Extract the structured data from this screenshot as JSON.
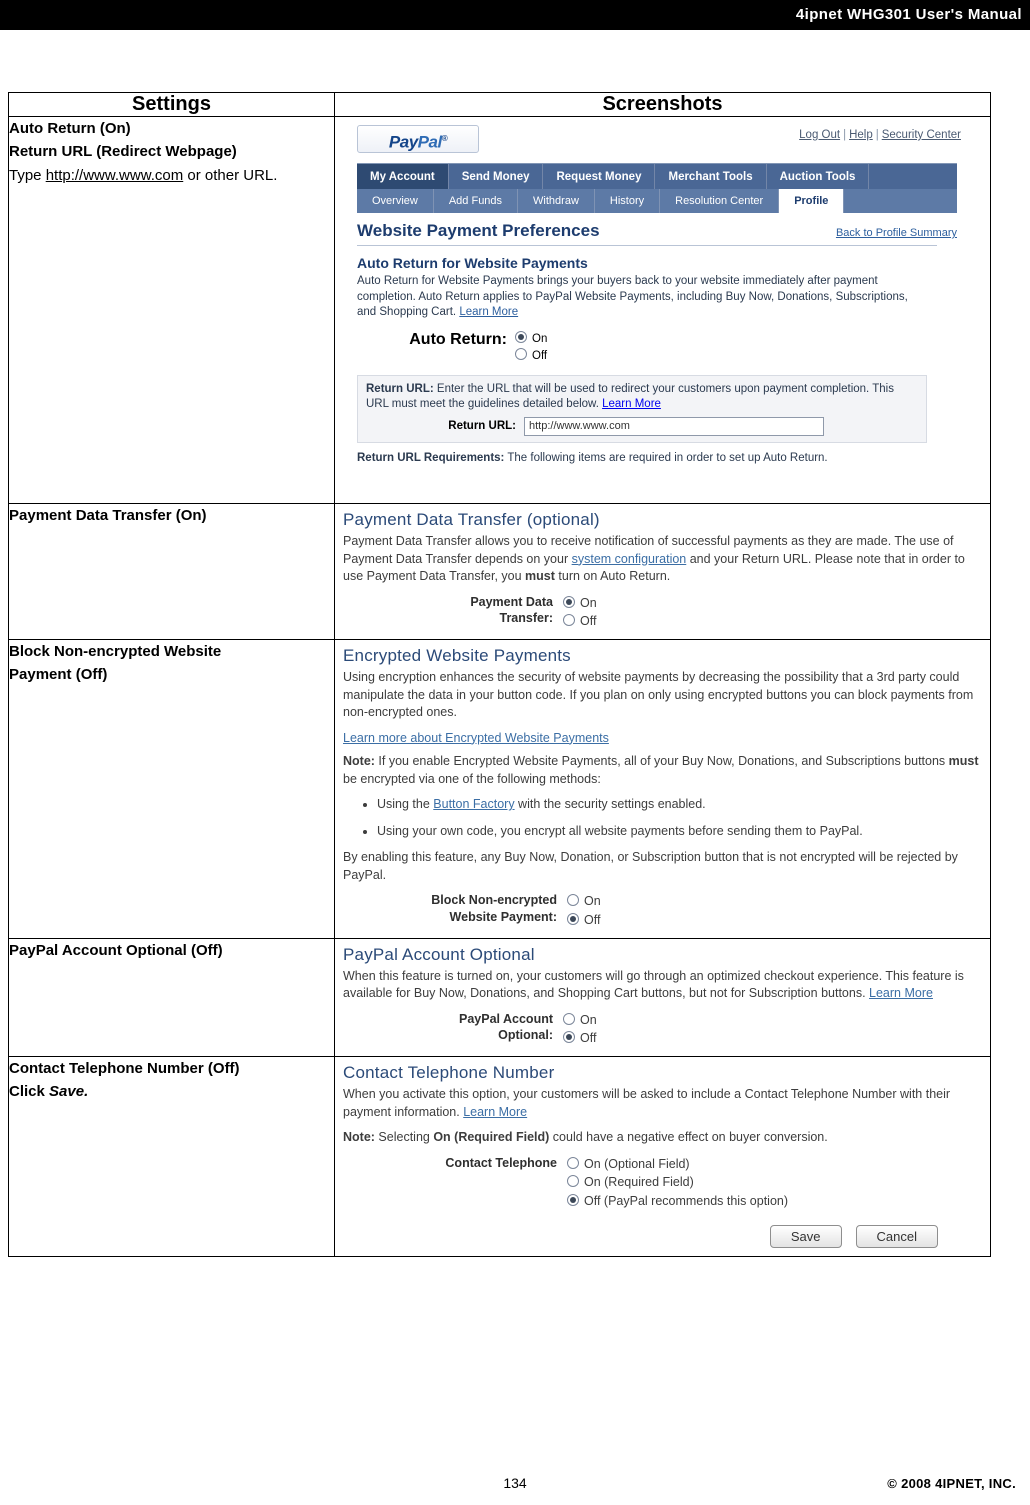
{
  "header": {
    "manual_title": "4ipnet WHG301 User's Manual"
  },
  "table": {
    "headers": {
      "settings": "Settings",
      "screenshots": "Screenshots"
    },
    "rows": [
      {
        "settings": {
          "line1": "Auto Return (On)",
          "line2": "Return URL (Redirect Webpage)",
          "line3_pre": "Type ",
          "line3_link": "http://www.www.com",
          "line3_post": " or other URL."
        }
      },
      {
        "settings": {
          "line1": "Payment Data Transfer (On)"
        }
      },
      {
        "settings": {
          "line1": "Block Non-encrypted Website",
          "line2": "Payment (Off)"
        }
      },
      {
        "settings": {
          "line1": "PayPal Account Optional (Off)"
        }
      },
      {
        "settings": {
          "line1": "Contact Telephone Number (Off)",
          "line2_pre": "Click ",
          "line2_em": "Save."
        }
      }
    ]
  },
  "shot1": {
    "logo_pay": "Pay",
    "logo_pal": "Pal",
    "logo_reg": "®",
    "toplinks": {
      "logout": "Log Out",
      "help": "Help",
      "security": "Security Center"
    },
    "nav_primary": [
      "My Account",
      "Send Money",
      "Request Money",
      "Merchant Tools",
      "Auction Tools"
    ],
    "nav_primary_selected": "My Account",
    "nav_secondary": [
      "Overview",
      "Add Funds",
      "Withdraw",
      "History",
      "Resolution Center",
      "Profile"
    ],
    "nav_secondary_selected": "Profile",
    "page_title": "Website Payment Preferences",
    "back_link": "Back to Profile Summary",
    "section_title": "Auto Return for Website Payments",
    "section_text": "Auto Return for Website Payments brings your buyers back to your website immediately after payment completion. Auto Return applies to PayPal Website Payments, including Buy Now, Donations, Subscriptions, and Shopping Cart.",
    "section_text_link": "Learn More",
    "auto_return_label": "Auto Return:",
    "auto_return_on": "On",
    "auto_return_off": "Off",
    "auto_return_value": "On",
    "return_url_note_bold": "Return URL:",
    "return_url_note": " Enter the URL that will be used to redirect your customers upon payment completion. This URL must meet the guidelines detailed below.",
    "return_url_note_link": "Learn More",
    "return_url_label": "Return URL:",
    "return_url_value": "http://www.www.com",
    "requirements_bold": "Return URL Requirements:",
    "requirements_text": " The following items are required in order to set up Auto Return."
  },
  "shot2": {
    "title": "Payment Data Transfer (optional)",
    "text_pre": "Payment Data Transfer allows you to receive notification of successful payments as they are made. The use of Payment Data Transfer depends on your ",
    "text_link": "system configuration",
    "text_mid": " and your Return URL. Please note that in order to use Payment Data Transfer, you ",
    "text_bold": "must",
    "text_post": " turn on Auto Return.",
    "label_line1": "Payment Data",
    "label_line2": "Transfer:",
    "opt_on": "On",
    "opt_off": "Off",
    "value": "On"
  },
  "shot3": {
    "title": "Encrypted Website Payments",
    "para1": "Using encryption enhances the security of website payments by decreasing the possibility that a 3rd party could manipulate the data in your button code. If you plan on only using encrypted buttons you can block payments from non-encrypted ones.",
    "link1": "Learn more about Encrypted Website Payments",
    "note_bold": "Note:",
    "note_text_pre": " If you enable Encrypted Website Payments, all of your Buy Now, Donations, and Subscriptions buttons ",
    "note_bold2": "must",
    "note_text_post": " be encrypted via one of the following methods:",
    "bullet1_pre": "Using the ",
    "bullet1_link": "Button Factory",
    "bullet1_post": " with the security settings enabled.",
    "bullet2": "Using your own code, you encrypt all website payments before sending them to PayPal.",
    "para2": "By enabling this feature, any Buy Now, Donation, or Subscription button that is not encrypted will be rejected by PayPal.",
    "label_line1": "Block Non-encrypted",
    "label_line2": "Website Payment:",
    "opt_on": "On",
    "opt_off": "Off",
    "value": "Off"
  },
  "shot4": {
    "title": "PayPal Account Optional",
    "para1": "When this feature is turned on, your customers will go through an optimized checkout experience. This feature is available for Buy Now, Donations, and Shopping Cart buttons, but not for Subscription buttons. ",
    "link1": "Learn More",
    "label_line1": "PayPal Account",
    "label_line2": "Optional:",
    "opt_on": "On",
    "opt_off": "Off",
    "value": "Off"
  },
  "shot5": {
    "title": "Contact Telephone Number",
    "para1": "When you activate this option, your customers will be asked to include a Contact Telephone Number with their payment information. ",
    "link1": "Learn More",
    "note_bold": "Note:",
    "note_pre": " Selecting ",
    "note_bold2": "On (Required Field)",
    "note_post": " could have a negative effect on buyer conversion.",
    "label": "Contact Telephone",
    "opt_optional": "On (Optional Field)",
    "opt_required": "On (Required Field)",
    "opt_off": "Off (PayPal recommends this option)",
    "value": "Off (PayPal recommends this option)",
    "save_label": "Save",
    "cancel_label": "Cancel"
  },
  "footer": {
    "page_number": "134",
    "copyright": "© 2008 4IPNET, INC."
  }
}
